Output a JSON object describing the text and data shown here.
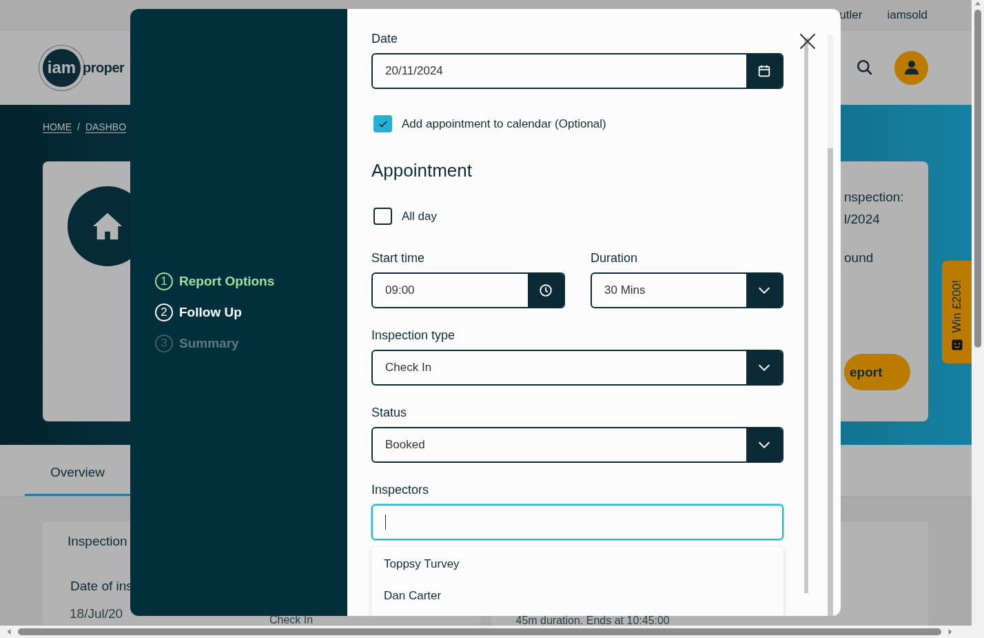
{
  "top_nav": {
    "links": [
      "utler",
      "iamsold"
    ]
  },
  "header": {
    "logo": {
      "mark": "iam",
      "text": "proper"
    }
  },
  "breadcrumb": {
    "items": [
      "HOME",
      "DASHBO"
    ],
    "separator": "/"
  },
  "property_card": {
    "lines": [
      "nspection:",
      "l/2024",
      "ound"
    ],
    "button": "eport"
  },
  "feedback_tab": {
    "label": "Win £200!"
  },
  "tabs": [
    {
      "label": "Overview",
      "selected": true
    }
  ],
  "inspection_card": {
    "title": "Inspection",
    "field_label": "Date of ins",
    "field_value": "18/Jul/20",
    "column_2": "Check In"
  },
  "second_card": {
    "text": "45m duration. Ends at 10:45:00"
  },
  "modal": {
    "steps": [
      {
        "number": "1",
        "label": "Report Options",
        "completed": true,
        "selected": false
      },
      {
        "number": "2",
        "label": "Follow Up",
        "completed": false,
        "selected": true
      },
      {
        "number": "3",
        "label": "Summary",
        "completed": false,
        "selected": false
      }
    ],
    "form": [
      {
        "kind": "date",
        "label": "Date",
        "value": "20/11/2024"
      },
      {
        "kind": "checkbox",
        "label": "Add appointment to calendar (Optional)",
        "checked": true
      },
      {
        "kind": "heading",
        "text": "Appointment"
      },
      {
        "kind": "checkbox",
        "label": "All day",
        "checked": false
      },
      {
        "kind": "pair",
        "fields": [
          {
            "kind": "time",
            "label": "Start time",
            "value": "09:00"
          },
          {
            "kind": "select",
            "label": "Duration",
            "value": "30 Mins"
          }
        ]
      },
      {
        "kind": "select",
        "label": "Inspection type",
        "value": "Check In"
      },
      {
        "kind": "select",
        "label": "Status",
        "value": "Booked"
      },
      {
        "kind": "autocomplete",
        "label": "Inspectors",
        "focused": true,
        "options": [
          "Toppsy Turvey",
          "Dan Carter"
        ]
      }
    ]
  }
}
